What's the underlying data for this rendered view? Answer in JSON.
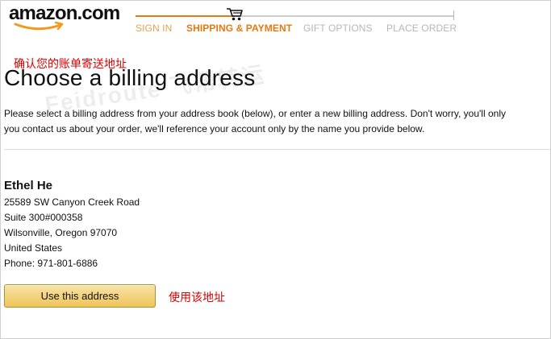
{
  "logo": {
    "text": "amazon.com"
  },
  "steps": [
    {
      "label": "SIGN IN",
      "state": "done"
    },
    {
      "label": "SHIPPING & PAYMENT",
      "state": "current"
    },
    {
      "label": "GIFT OPTIONS",
      "state": "todo"
    },
    {
      "label": "PLACE ORDER",
      "state": "todo"
    }
  ],
  "annotations": {
    "heading_note": "确认您的账单寄送地址",
    "button_note": "使用该地址"
  },
  "page_title": "Choose a billing address",
  "intro": {
    "line1": "Please select a billing address from your address book (below), or enter a new billing address.  Don't worry, you'll only",
    "line2": "you contact us about your order, we'll reference your account only by the name you provide below."
  },
  "address": {
    "name": "Ethel He",
    "lines": [
      "25589 SW Canyon Creek Road",
      "Suite 300#000358",
      "Wilsonville, Oregon 97070",
      "United States",
      "Phone: 971-801-6886"
    ]
  },
  "use_address_button": "Use this address",
  "watermark": "Feidroute 飞帮转运",
  "colors": {
    "accent_orange": "#e47911",
    "annotation_red": "#e00000",
    "button_gold": "#eec55b"
  }
}
